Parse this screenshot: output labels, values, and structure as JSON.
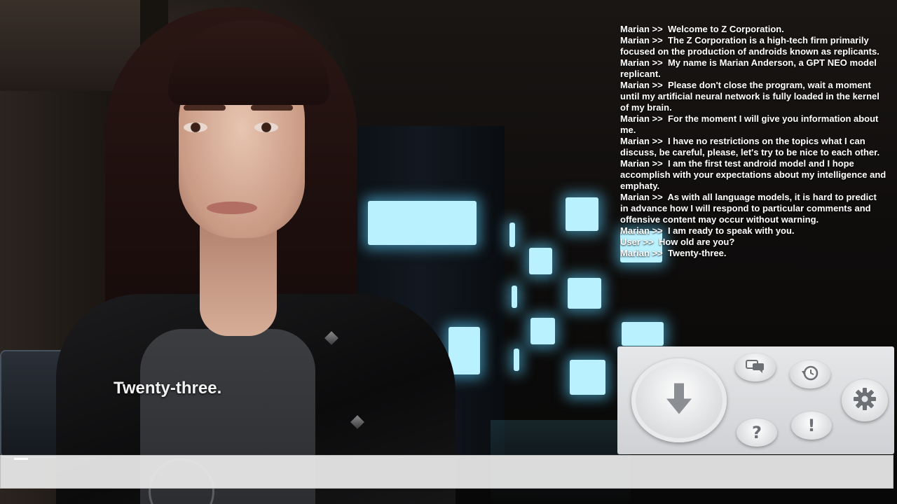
{
  "subtitle": "Twenty-three.",
  "chat_log": [
    {
      "speaker": "Marian >>",
      "text": "Welcome to Z Corporation."
    },
    {
      "speaker": "Marian >>",
      "text": "The Z Corporation is a high-tech firm primarily focused on the production of androids known as replicants."
    },
    {
      "speaker": "Marian >>",
      "text": "My name is Marian Anderson, a GPT NEO model replicant."
    },
    {
      "speaker": "Marian >>",
      "text": "Please don't close the program, wait a moment until my artificial neural network is fully loaded in the kernel of my brain."
    },
    {
      "speaker": "Marian >>",
      "text": "For the moment I will give you information about me."
    },
    {
      "speaker": "Marian >>",
      "text": "I have no restrictions on the topics what I can discuss, be careful, please, let's try to be nice to each other."
    },
    {
      "speaker": "Marian >>",
      "text": "I am the first test android model and I hope accomplish with your expectations about my intelligence and emphaty."
    },
    {
      "speaker": "Marian >>",
      "text": "As with all language models, it is hard to predict in advance how I will respond to particular comments and offensive content may occur without warning."
    },
    {
      "speaker": "Marian >>",
      "text": "I am ready to speak with you."
    },
    {
      "speaker": "User >>",
      "text": "How old are you?"
    },
    {
      "speaker": "Marian >>",
      "text": "Twenty-three."
    }
  ],
  "panel": {
    "big_button_icon": "download-arrow-icon",
    "buttons": [
      {
        "icon": "chat-bubbles-icon"
      },
      {
        "icon": "history-icon"
      },
      {
        "icon": "gear-icon"
      },
      {
        "icon": "help-icon",
        "glyph": "?"
      },
      {
        "icon": "alert-icon",
        "glyph": "!"
      }
    ]
  },
  "input": {
    "value": "",
    "placeholder": ""
  },
  "colors": {
    "glow": "#b9f1ff",
    "panel": "#dcdee0",
    "text": "#ffffff"
  }
}
